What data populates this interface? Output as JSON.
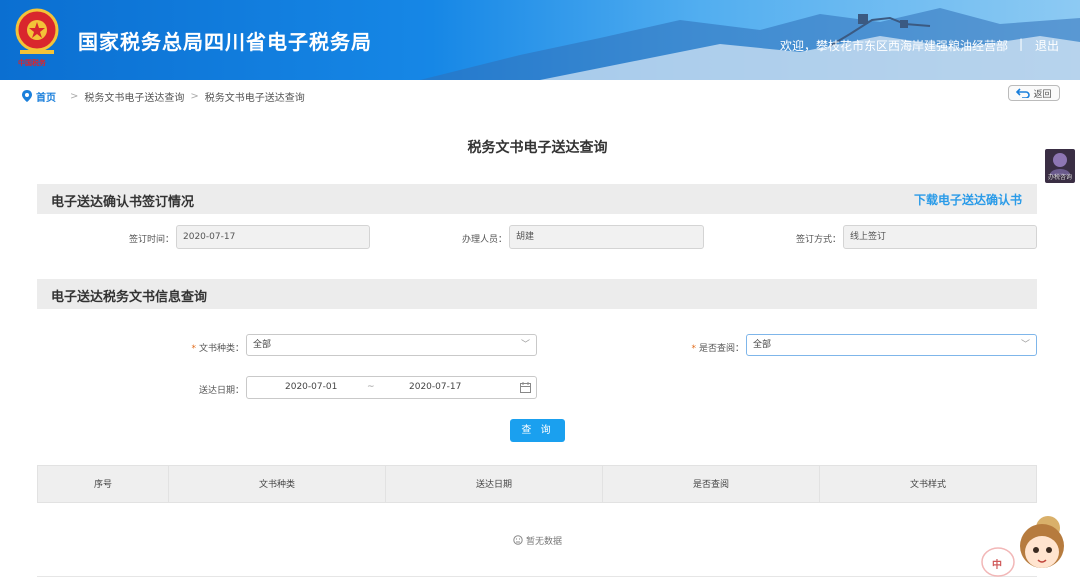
{
  "header": {
    "site_title": "国家税务总局四川省电子税务局",
    "welcome": "欢迎，攀枝花市东区西海岸建强粮油经营部",
    "separator": "|",
    "logout": "退出",
    "emblem_text": "中国税务"
  },
  "breadcrumb": {
    "home": "首页",
    "items": [
      "税务文书电子送达查询",
      "税务文书电子送达查询"
    ],
    "arrow": ">"
  },
  "back_button": "返回",
  "page_title": "税务文书电子送达查询",
  "side_tool_label": "办税咨询",
  "section1": {
    "title": "电子送达确认书签订情况",
    "download_link": "下载电子送达确认书",
    "sign_time_label": "签订时间：",
    "sign_time_value": "2020-07-17",
    "handler_label": "办理人员：",
    "handler_value": "胡建",
    "sign_method_label": "签订方式：",
    "sign_method_value": "线上签订"
  },
  "section2": {
    "title": "电子送达税务文书信息查询",
    "doc_type_label": "文书种类：",
    "doc_type_value": "全部",
    "viewed_label": "是否查阅：",
    "viewed_value": "全部",
    "date_label": "送达日期：",
    "date_start": "2020-07-01",
    "date_sep": "~",
    "date_end": "2020-07-17",
    "query_button": "查 询"
  },
  "table": {
    "columns": [
      "序号",
      "文书种类",
      "送达日期",
      "是否查阅",
      "文书样式"
    ],
    "empty_text": "暂无数据"
  },
  "mascot_text": "中"
}
